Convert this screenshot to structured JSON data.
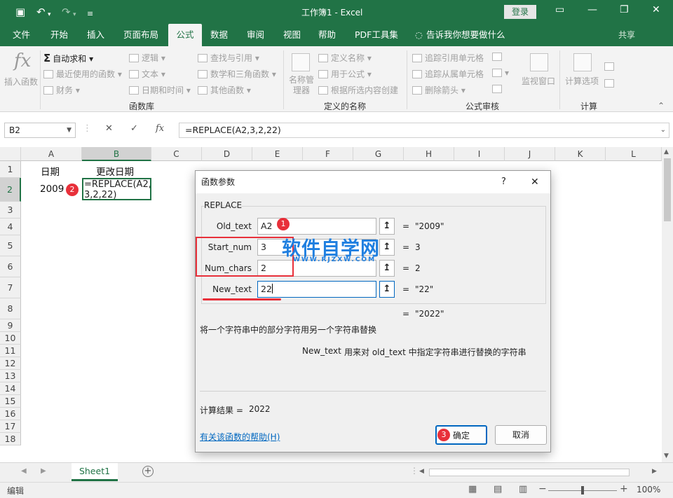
{
  "titlebar": {
    "title": "工作簿1  -  Excel",
    "login": "登录",
    "save_icon": "save-icon",
    "undo_icon": "undo-icon",
    "redo_icon": "redo-icon"
  },
  "tabs": [
    "文件",
    "开始",
    "插入",
    "页面布局",
    "公式",
    "数据",
    "审阅",
    "视图",
    "帮助",
    "PDF工具集",
    "告诉我你想要做什么"
  ],
  "share": "共享",
  "ribbon": {
    "insert_function": "插入函数",
    "autosum": "自动求和",
    "recent": "最近使用的函数",
    "financial": "财务",
    "logical": "逻辑",
    "text": "文本",
    "datetime": "日期和时间",
    "lookup": "查找与引用",
    "math": "数学和三角函数",
    "other": "其他函数",
    "name_manager": "名称管理器",
    "define_name": "定义名称",
    "use_in_formula": "用于公式",
    "create_from_selection": "根据所选内容创建",
    "trace_precedents": "追踪引用单元格",
    "trace_dependents": "追踪从属单元格",
    "remove_arrows": "删除箭头",
    "watch_window": "监视窗口",
    "calc_options": "计算选项",
    "group_library": "函数库",
    "group_names": "定义的名称",
    "group_audit": "公式审核",
    "group_calc": "计算"
  },
  "formula_bar": {
    "name_box": "B2",
    "cancel": "✕",
    "enter": "✓",
    "fx": "fx",
    "content": "=REPLACE(A2,3,2,22)"
  },
  "columns": [
    "A",
    "B",
    "C",
    "D",
    "E",
    "F",
    "G",
    "H",
    "I",
    "J",
    "K",
    "L"
  ],
  "rows": [
    "1",
    "2",
    "3",
    "4",
    "5",
    "6",
    "7",
    "8",
    "9",
    "10",
    "11",
    "12",
    "13",
    "14",
    "15",
    "16",
    "17",
    "18"
  ],
  "cells": {
    "A1": "日期",
    "B1": "更改日期",
    "A2": "2009",
    "B2_line1": "=REPLACE(A2,",
    "B2_line2": "3,2,22)"
  },
  "badges": {
    "b1": "1",
    "b2": "2",
    "b3": "3"
  },
  "sheet": {
    "tab": "Sheet1",
    "add": "+"
  },
  "status": {
    "mode": "编辑",
    "zoom": "100%",
    "minus": "−",
    "plus": "+"
  },
  "dialog": {
    "title": "函数参数",
    "help_mark": "?",
    "close": "✕",
    "function_name": "REPLACE",
    "args": [
      {
        "label": "Old_text",
        "value": "A2",
        "result": "\"2009\""
      },
      {
        "label": "Start_num",
        "value": "3",
        "result": "3"
      },
      {
        "label": "Num_chars",
        "value": "2",
        "result": "2"
      },
      {
        "label": "New_text",
        "value": "22",
        "result": "\"22\""
      }
    ],
    "eq": "=",
    "total": "\"2022\"",
    "description": "将一个字符串中的部分字符用另一个字符串替换",
    "arg_desc_name": "New_text",
    "arg_desc": "用来对 old_text 中指定字符串进行替换的字符串",
    "calc_label": "计算结果 =",
    "calc_value": "2022",
    "help_link": "有关该函数的帮助(H)",
    "ok": "确定",
    "cancel": "取消"
  },
  "watermark": {
    "main": "软件自学网",
    "sub": "WWW.RJZXW.COM"
  },
  "colors": {
    "excel_green": "#217346",
    "badge_red": "#e8303a",
    "highlight_red": "#e8303a",
    "link_blue": "#0067c0"
  }
}
